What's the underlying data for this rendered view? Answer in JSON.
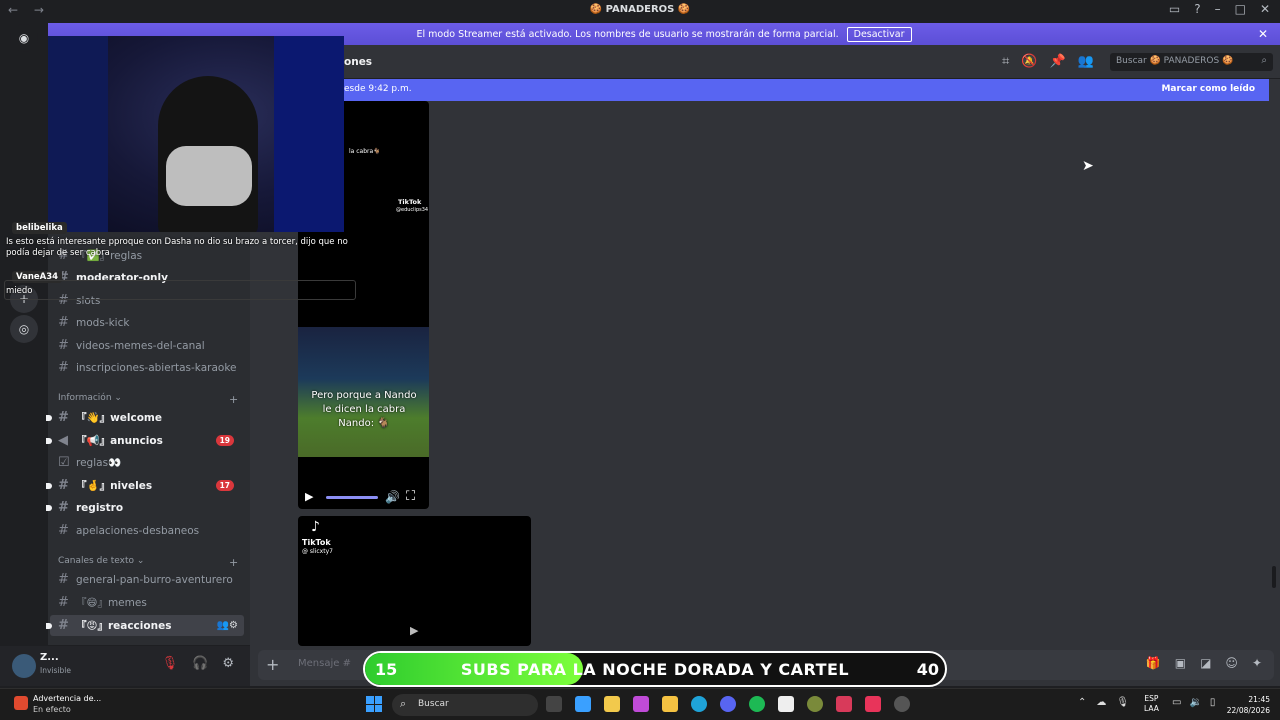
{
  "window": {
    "title": "🍪 PANADEROS 🍪",
    "nav_back": "←",
    "nav_forward": "→"
  },
  "streamer": {
    "message": "El modo Streamer está activado. Los nombres de usuario se mostrarán de forma parcial.",
    "button": "Desactivar",
    "close": "✕"
  },
  "header": {
    "channel_title_partial": "ones",
    "search_placeholder": "Buscar 🍪 PANADEROS 🍪"
  },
  "new_messages": {
    "text": "esde 9:42 p.m.",
    "mark_read": "Marcar como leído"
  },
  "sidebar": {
    "channels_top": [
      {
        "name": "『✅』reglas",
        "unread": false
      },
      {
        "name": "moderator-only",
        "unread": true
      },
      {
        "name": "slots",
        "unread": false
      },
      {
        "name": "mods-kick",
        "unread": false
      },
      {
        "name": "videos-memes-del-canal",
        "unread": false
      },
      {
        "name": "inscripciones-abiertas-karaoke",
        "unread": false
      }
    ],
    "category_info": "Información",
    "info_channels": [
      {
        "name": "『👋』welcome",
        "unread": true,
        "badge": ""
      },
      {
        "name": "『📢』anuncios",
        "unread": true,
        "badge": "19"
      },
      {
        "name": "reglas👀",
        "unread": false,
        "badge": ""
      },
      {
        "name": "『🤞』niveles",
        "unread": true,
        "badge": "17"
      },
      {
        "name": "registro",
        "unread": true,
        "badge": ""
      },
      {
        "name": "apelaciones-desbaneos",
        "unread": false,
        "badge": ""
      }
    ],
    "category_text": "Canales de texto",
    "text_channels": [
      {
        "name": "general-pan-burro-aventurero",
        "unread": false
      },
      {
        "name": "『😄』memes",
        "unread": false
      },
      {
        "name": "『😡』reacciones",
        "unread": true,
        "active": true
      }
    ]
  },
  "user": {
    "name": "Z...",
    "status": "Invisible"
  },
  "videos": {
    "v1_caption": "la cabra🐐",
    "tiktok": "TikTok",
    "v1_handle": "@educlips34",
    "v2_caption": "Pero porque a Nando le dicen la cabra Nando: 🐐",
    "v3_handle": "@ slicxty7"
  },
  "composer": {
    "placeholder": "Mensaje #"
  },
  "stream_chat": [
    {
      "user": "belibelika",
      "text": "Is esto está interesante pproque con Dasha no dio su brazo a torcer, dijo que no podía dejar de ser cabra"
    },
    {
      "user": "VaneA34",
      "text": "miedo"
    }
  ],
  "subs_goal": {
    "current": "15",
    "goal": "40",
    "text": "SUBS PARA LA NOCHE DORADA Y CARTEL",
    "progress": 0.375
  },
  "taskbar": {
    "notification_title": "Advertencia de...",
    "notification_sub": "En efecto",
    "search": "Buscar",
    "lang1": "ESP",
    "lang2": "LAA",
    "time": "21:45",
    "date": "22/08/2026"
  },
  "colors": {
    "accent": "#5865f2",
    "badge": "#da373c",
    "progress": "#2ecc2e"
  }
}
